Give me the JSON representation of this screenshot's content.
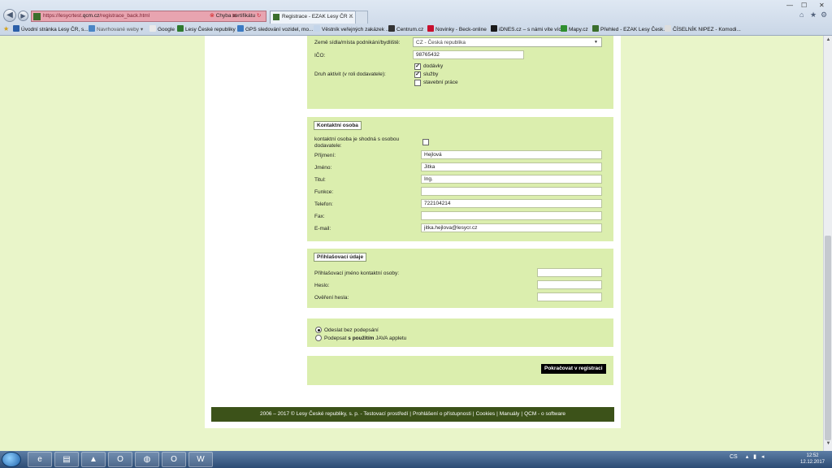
{
  "browser": {
    "url_prefix": "https://lesycrtest.",
    "url_domain": "qcm.cz",
    "url_path": "/registrace_back.html",
    "cert_error": "Chyba certifikátu",
    "tab_title": "Registrace - EZAK Lesy ČR ...",
    "window_controls": [
      "—",
      "☐",
      "✕"
    ],
    "toolbar_icons": [
      "⌂",
      "★",
      "⚙"
    ]
  },
  "bookmarks": [
    {
      "label": "Úvodní stránka Lesy ČR, s...",
      "color": "#2b5fa8"
    },
    {
      "label": "Navrhované weby ▾",
      "color": "#4a86c5"
    },
    {
      "label": "Google",
      "color": "#e9e9e9"
    },
    {
      "label": "Lesy České republiky",
      "color": "#2e7a2e"
    },
    {
      "label": "GPS sledování vozidel, mo...",
      "color": "#3b7ac3"
    },
    {
      "label": "Věstník veřejných zakázek ...",
      "color": "#c4d5ea"
    },
    {
      "label": "Centrum.cz",
      "color": "#333333"
    },
    {
      "label": "Novinky - Beck-online",
      "color": "#c8102e"
    },
    {
      "label": "iDNES.cz – s námi víte víc",
      "color": "#1a1a1a"
    },
    {
      "label": "Mapy.cz",
      "color": "#2f8f2f"
    },
    {
      "label": "Přehled - EZAK Lesy Česk...",
      "color": "#3a6e2c"
    },
    {
      "label": "ČÍSELNÍK NIPEZ - Komodi...",
      "color": "#dddddd"
    }
  ],
  "supplier": {
    "country_label": "Země sídla/místa podnikání/bydliště:",
    "country_value": "CZ - Česká republika",
    "ico_label": "IČO:",
    "ico_value": "98765432",
    "activity_label": "Druh aktivit (v roli dodavatele):",
    "activities": [
      {
        "label": "dodávky",
        "checked": true
      },
      {
        "label": "služby",
        "checked": true
      },
      {
        "label": "stavební práce",
        "checked": false
      }
    ]
  },
  "contact": {
    "legend": "Kontaktní osoba",
    "same_as_supplier_label": "kontaktní osoba je shodná s osobou dodavatele:",
    "fields": [
      {
        "label": "Příjmení:",
        "value": "Hejlová"
      },
      {
        "label": "Jméno:",
        "value": "Jitka"
      },
      {
        "label": "Titul:",
        "value": "Ing."
      },
      {
        "label": "Funkce:",
        "value": ""
      },
      {
        "label": "Telefon:",
        "value": "722104214"
      },
      {
        "label": "Fax:",
        "value": ""
      },
      {
        "label": "E-mail:",
        "value": "jitka.hejlova@lesycr.cz"
      }
    ]
  },
  "login": {
    "legend": "Přihlašovací údaje",
    "fields": [
      {
        "label": "Přihlašovací jméno kontaktní osoby:",
        "value": ""
      },
      {
        "label": "Heslo:",
        "value": ""
      },
      {
        "label": "Ověření hesla:",
        "value": ""
      }
    ]
  },
  "signing": {
    "option_no_sign": "Odeslat bez podepsání",
    "option_sign_pre": "Podepsat ",
    "option_sign_bold": "s použitím",
    "option_sign_post": " JAVA appletu"
  },
  "actions": {
    "continue_label": "Pokračovat v registraci"
  },
  "footer": {
    "copyright": "2006 – 2017 © Lesy České republiky, s. p. - Testovací prostředí",
    "accessibility": "Prohlášení o přístupnosti",
    "cookies": "Cookies",
    "manuals": "Manuály",
    "qcm": "QCM - o software"
  },
  "taskbar": {
    "tray_lang": "CS",
    "time": "12:52",
    "date": "12.12.2017"
  }
}
